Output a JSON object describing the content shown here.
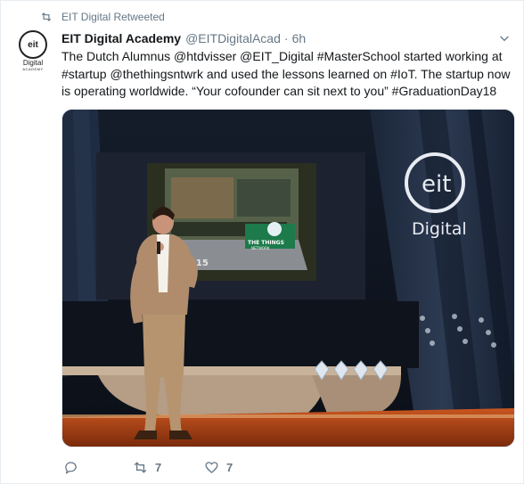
{
  "retweet": {
    "label": "EIT Digital Retweeted",
    "icon": "retweet-icon"
  },
  "tweet": {
    "author_name": "EIT Digital Academy",
    "author_handle": "@EITDigitalAcad",
    "separator": "·",
    "time": "6h",
    "text": "The Dutch Alumnus @htdvisser @EIT_Digital #MasterSchool started working at #startup @thethingsntwrk and used the lessons learned on #IoT. The startup now is operating worldwide. “Your cofounder can sit next to you” #GraduationDay18",
    "avatar": {
      "logo_text": "eit",
      "line1": "Digital",
      "line2": "ACADEMY"
    },
    "image": {
      "banner_logo": "eit",
      "banner_text": "Digital",
      "screen_text": "THE THINGS",
      "screen_subtext": "NETWORK",
      "screen_year": "2015"
    }
  },
  "actions": {
    "reply_count": "",
    "retweet_count": "7",
    "like_count": "7"
  },
  "colors": {
    "secondary_text": "#657786",
    "link": "#1da1f2",
    "border": "#e6ecf0"
  }
}
